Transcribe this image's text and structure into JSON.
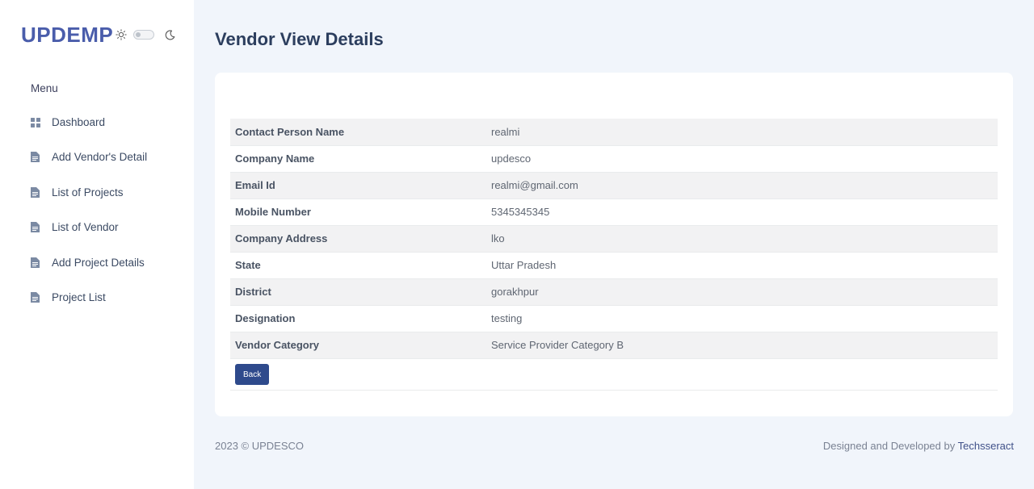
{
  "brand": {
    "name": "UPDEMP",
    "toggle_state": "off"
  },
  "menu": {
    "title": "Menu",
    "items": [
      {
        "label": "Dashboard",
        "icon": "grid-icon"
      },
      {
        "label": "Add Vendor's Detail",
        "icon": "document-icon"
      },
      {
        "label": "List of Projects",
        "icon": "document-icon"
      },
      {
        "label": "List of Vendor",
        "icon": "document-icon"
      },
      {
        "label": "Add Project Details",
        "icon": "document-icon"
      },
      {
        "label": "Project List",
        "icon": "document-icon"
      }
    ]
  },
  "page": {
    "title": "Vendor View Details"
  },
  "details": [
    {
      "key": "Contact Person Name",
      "value": "realmi"
    },
    {
      "key": "Company Name",
      "value": "updesco"
    },
    {
      "key": "Email Id",
      "value": "realmi@gmail.com"
    },
    {
      "key": "Mobile Number",
      "value": "5345345345"
    },
    {
      "key": "Company Address",
      "value": "lko"
    },
    {
      "key": "State",
      "value": "Uttar Pradesh"
    },
    {
      "key": "District",
      "value": "gorakhpur"
    },
    {
      "key": "Designation",
      "value": "testing"
    },
    {
      "key": "Vendor Category",
      "value": "Service Provider Category B"
    }
  ],
  "actions": {
    "back_label": "Back"
  },
  "footer": {
    "copyright": "2023 © UPDESCO",
    "credit_prefix": "Designed and Developed by",
    "credit_link": "Techsseract"
  },
  "colors": {
    "brand": "#4a5dab",
    "primary_button": "#2e4a8c",
    "background": "#f1f5fb"
  }
}
